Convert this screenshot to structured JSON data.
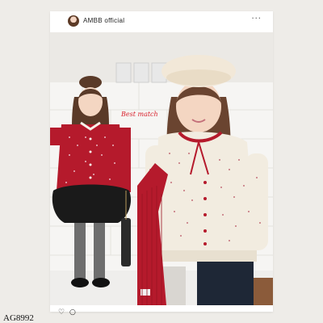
{
  "post": {
    "account_name": "AMBB official",
    "more_icon": "more-icon",
    "avatar_icon": "avatar",
    "like_icon": "heart-icon",
    "comment_icon": "comment-icon"
  },
  "photo": {
    "caption_overlay": "Best match"
  },
  "product": {
    "code": "AG8992"
  },
  "colors": {
    "background": "#eeece8",
    "card": "#ffffff",
    "cardigan_red": "#b51a2c",
    "cardigan_cream": "#f2ece0",
    "overlay_text": "#d8232e"
  }
}
